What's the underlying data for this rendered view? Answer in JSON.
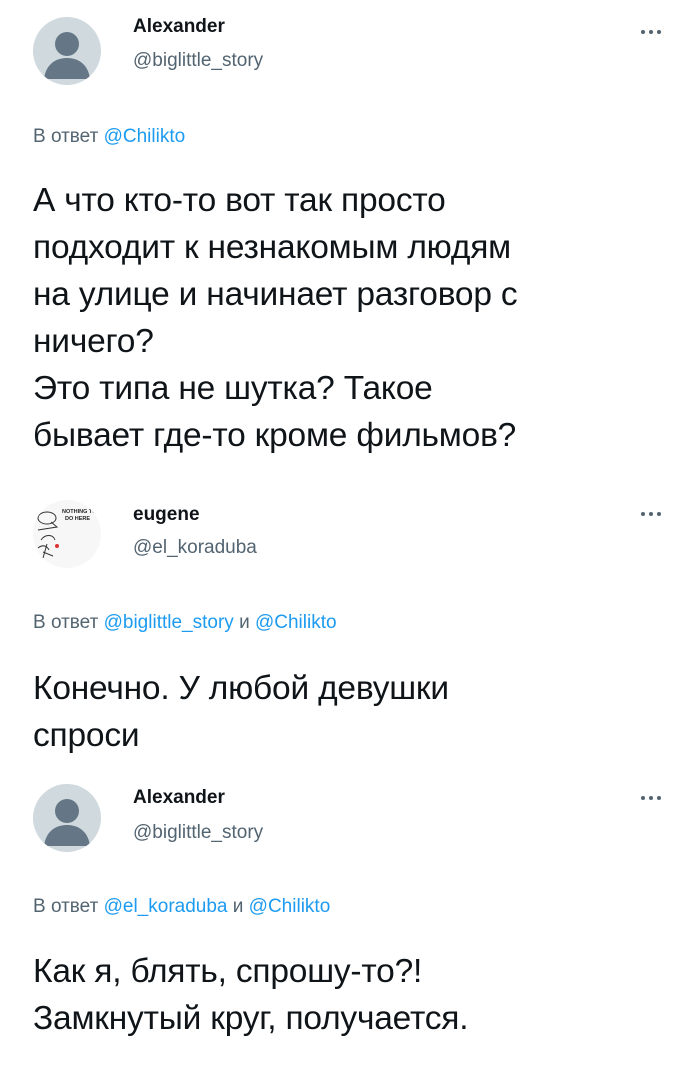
{
  "tweets": [
    {
      "display_name": "Alexander",
      "handle": "@biglittle_story",
      "reply_prefix": "В ответ",
      "reply_mention_1": "@Chilikto",
      "text_lines": [
        "А что кто-то вот так просто",
        "подходит к незнакомым людям",
        "на улице и начинает разговор с",
        "ничего?",
        "Это типа не шутка? Такое",
        "бывает где-то кроме фильмов?"
      ],
      "avatar_icon": "default-avatar-icon"
    },
    {
      "display_name": "eugene",
      "handle": "@el_koraduba",
      "reply_prefix": "В ответ",
      "reply_mention_1": "@biglittle_story",
      "reply_joiner": "и",
      "reply_mention_2": "@Chilikto",
      "text_lines": [
        "Конечно. У любой девушки",
        "спроси"
      ],
      "avatar_meme_lines": [
        "NOTHING TO",
        "DO HERE"
      ],
      "avatar_icon": "meme-sketch-avatar"
    },
    {
      "display_name": "Alexander",
      "handle": "@biglittle_story",
      "reply_prefix": "В ответ",
      "reply_mention_1": "@el_koraduba",
      "reply_joiner": "и",
      "reply_mention_2": "@Chilikto",
      "text_lines": [
        "Как я, блять, спрошу-то?!",
        "Замкнутый круг, получается."
      ],
      "avatar_icon": "default-avatar-icon"
    }
  ],
  "colors": {
    "text": "#0f1419",
    "secondary": "#536471",
    "mention": "#1d9bf0",
    "avatar_bg": "#cfd9de",
    "avatar_silhouette": "#657786"
  },
  "more_icon": "more-dots-icon"
}
